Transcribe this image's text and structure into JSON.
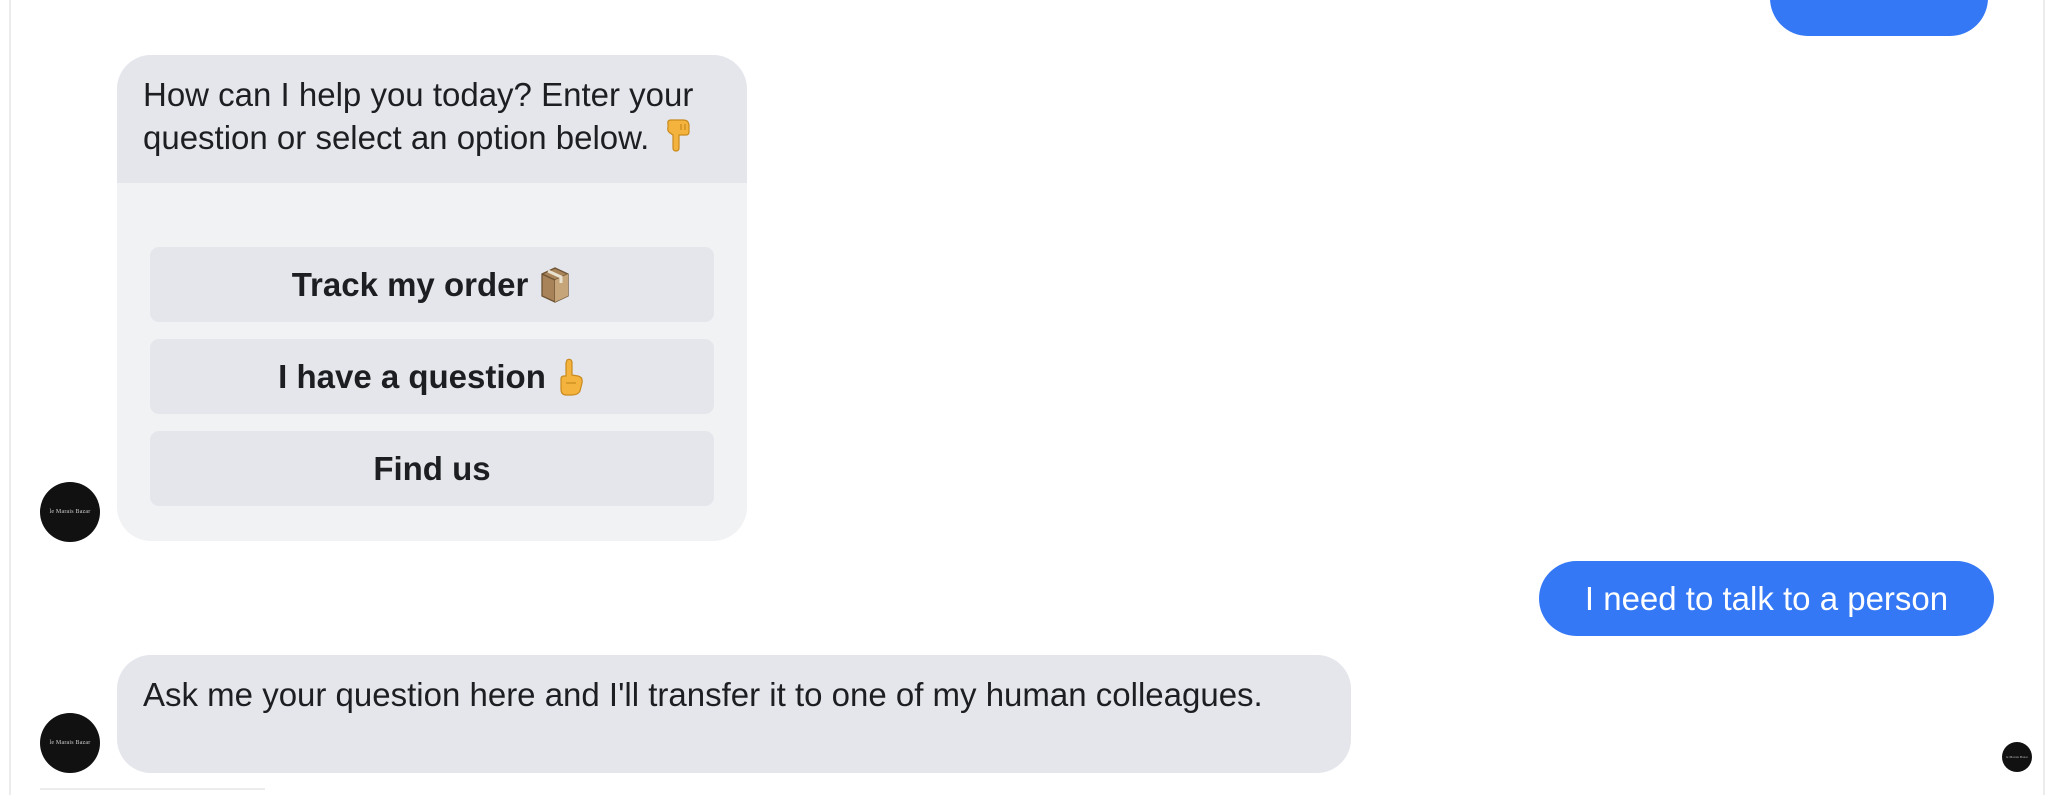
{
  "conversation": {
    "bot_avatar_text": "le Marais Bazar",
    "user_avatar_text": "le Marais Bazar",
    "bot_welcome": {
      "text": "How can I help you today? Enter your question or select an option below.",
      "emoji_icon": "backhand-index-pointing-down-icon"
    },
    "quick_replies": [
      {
        "label": "Track my order",
        "emoji_icon": "package-icon"
      },
      {
        "label": "I have a question",
        "emoji_icon": "index-pointing-up-icon"
      },
      {
        "label": "Find us",
        "emoji_icon": ""
      }
    ],
    "user_message": "I need to talk to a person",
    "bot_reply": "Ask me your question here and I'll transfer it to one of my human colleagues."
  },
  "colors": {
    "outgoing_bubble": "#3478f6",
    "incoming_bubble": "#e4e6eb",
    "card_body": "#f1f2f4",
    "text_dark": "#1c1e21",
    "avatar_bg": "#111111"
  }
}
